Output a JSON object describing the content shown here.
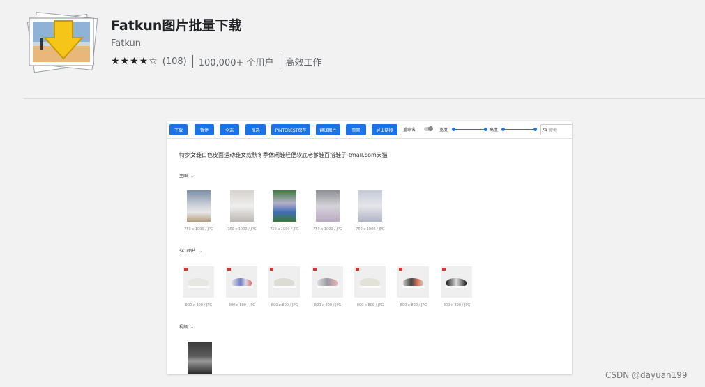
{
  "extension": {
    "title": "Fatkun图片批量下载",
    "author": "Fatkun",
    "stars": "★★★★☆",
    "rating_count": "(108)",
    "users": "100,000+ 个用户",
    "category": "高效工作"
  },
  "screenshot": {
    "toolbar": {
      "buttons": [
        "下载",
        "暂停",
        "全选",
        "反选",
        "PINTEREST保存",
        "翻译图片",
        "重置",
        "导出链接"
      ],
      "rename_label": "重命名",
      "width_label": "宽度",
      "height_label": "高度",
      "search_placeholder": "搜索"
    },
    "page_title": "特步女鞋白色皮面运动鞋女款秋冬季休闲鞋轻便软底老爹鞋百搭鞋子-tmall.com天猫",
    "sections": [
      {
        "label": "主图",
        "captions": [
          "750 x 1000 / JPG",
          "750 x 1000 / JPG",
          "750 x 1000 / JPG",
          "750 x 1000 / JPG",
          "750 x 1000 / JPG"
        ]
      },
      {
        "label": "SKU图片",
        "captions": [
          "800 x 800 / JPG",
          "800 x 800 / JPG",
          "800 x 800 / JPG",
          "800 x 800 / JPG",
          "800 x 800 / JPG",
          "800 x 800 / JPG",
          "800 x 800 / JPG"
        ]
      },
      {
        "label": "视频",
        "captions": []
      }
    ]
  },
  "watermark": "CSDN @dayuan199",
  "colors": {
    "accent": "#1a73e8",
    "page_bg": "#f2f2f2"
  },
  "icons": [
    "extension-icon",
    "search-icon",
    "chevron-down-icon"
  ]
}
